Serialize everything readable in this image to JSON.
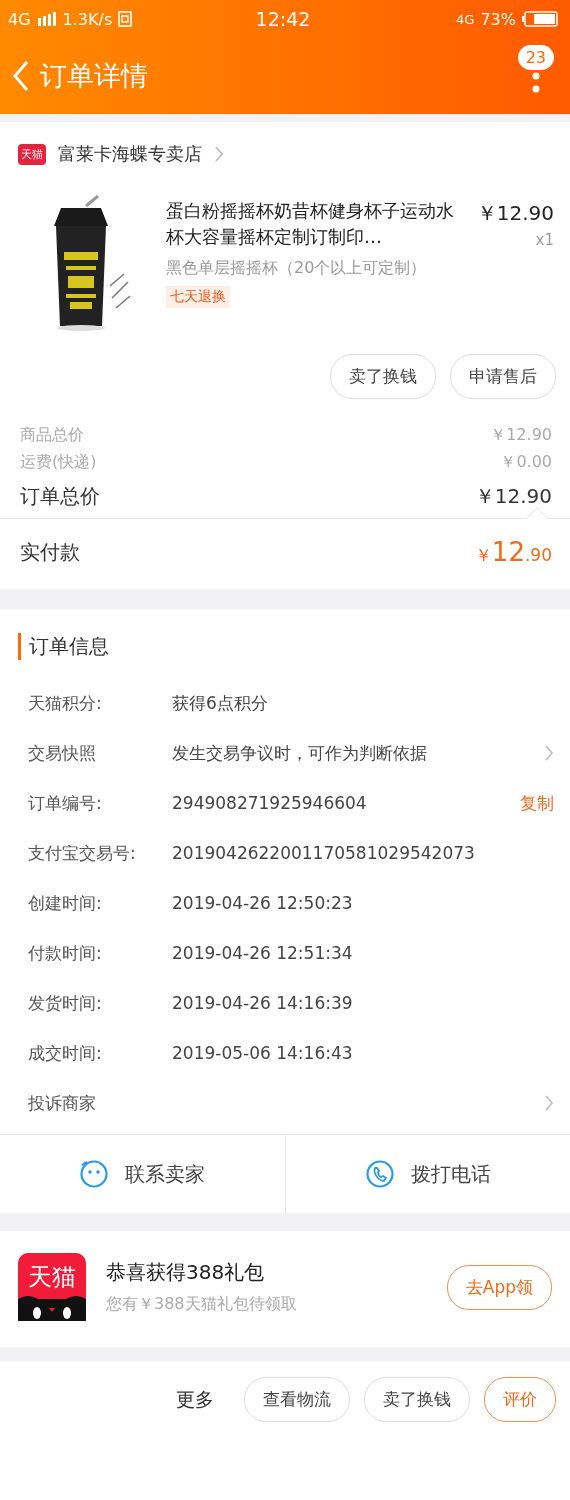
{
  "status_bar": {
    "network": "4G",
    "speed": "1.3K/s",
    "time": "12:42",
    "network_right": "4G",
    "battery": "73%"
  },
  "nav": {
    "title": "订单详情",
    "badge": "23"
  },
  "store": {
    "badge": "天猫",
    "name": "富莱卡海蝶专卖店"
  },
  "product": {
    "title": "蛋白粉摇摇杯奶昔杯健身杯子运动水杯大容量摇杯定制订制印…",
    "variant": "黑色单层摇摇杯（20个以上可定制）",
    "tag": "七天退换",
    "price": "￥12.90",
    "quantity": "x1"
  },
  "product_actions": [
    "卖了换钱",
    "申请售后"
  ],
  "price_lines": [
    {
      "label": "商品总价",
      "value": "￥12.90",
      "kind": "minor"
    },
    {
      "label": "运费(快递)",
      "value": "￥0.00",
      "kind": "minor"
    },
    {
      "label": "订单总价",
      "value": "￥12.90",
      "kind": "total"
    }
  ],
  "paid": {
    "label": "实付款",
    "currency": "￥",
    "integer": "12",
    "decimal": ".90"
  },
  "order_info": {
    "title": "订单信息",
    "rows": [
      {
        "label": "天猫积分:",
        "value": "获得6点积分",
        "kind": "plain"
      },
      {
        "label": "交易快照",
        "value": "发生交易争议时，可作为判断依据",
        "kind": "link"
      },
      {
        "label": "订单编号:",
        "value": "294908271925946604",
        "kind": "copy",
        "action": "复制"
      },
      {
        "label": "支付宝交易号:",
        "value": "2019042622001170581029542073",
        "kind": "plain"
      },
      {
        "label": "创建时间:",
        "value": "2019-04-26 12:50:23",
        "kind": "plain"
      },
      {
        "label": "付款时间:",
        "value": "2019-04-26 12:51:34",
        "kind": "plain"
      },
      {
        "label": "发货时间:",
        "value": "2019-04-26 14:16:39",
        "kind": "plain"
      },
      {
        "label": "成交时间:",
        "value": "2019-05-06 14:16:43",
        "kind": "plain"
      },
      {
        "label": "投诉商家",
        "kind": "link"
      }
    ]
  },
  "contact": [
    {
      "label": "联系卖家",
      "kind": "chat"
    },
    {
      "label": "拨打电话",
      "kind": "phone"
    }
  ],
  "promo": {
    "icon_text": "天猫",
    "title": "恭喜获得388礼包",
    "subtitle": "您有￥388天猫礼包待领取",
    "button": "去App领"
  },
  "bottom_bar": {
    "more": "更多",
    "buttons": [
      {
        "label": "查看物流",
        "kind": "normal"
      },
      {
        "label": "卖了换钱",
        "kind": "normal"
      },
      {
        "label": "评价",
        "kind": "primary"
      }
    ]
  }
}
